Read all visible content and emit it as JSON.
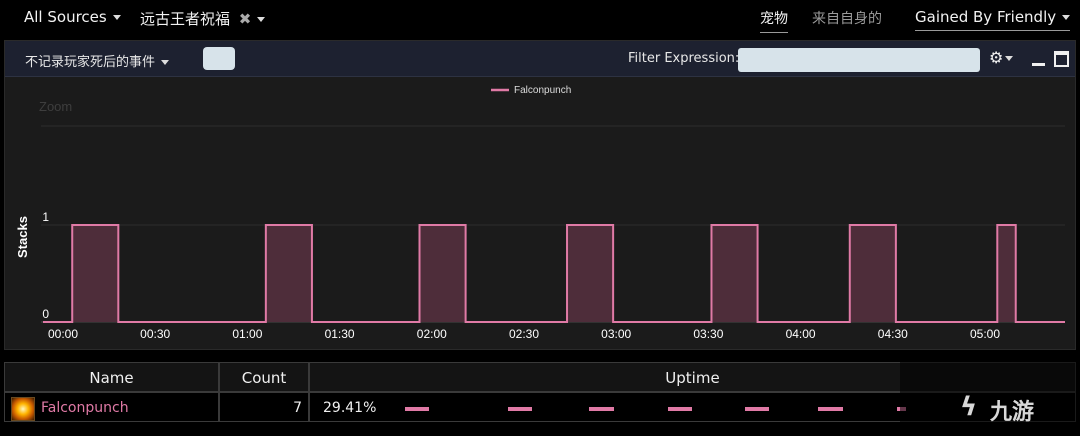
{
  "topbar": {
    "sources_label": "All Sources",
    "blessing_label": "远古王者祝福",
    "blessing_remove_glyph": "✖",
    "tab_pet": "宠物",
    "tab_self": "来自自身的",
    "mode_label": "Gained By Friendly"
  },
  "panel": {
    "death_filter_label": "不记录玩家死后的事件",
    "filter_label": "Filter Expression:",
    "filter_value": "",
    "gear_glyph": "⚙"
  },
  "chart_data": {
    "type": "line",
    "zoom_label": "Zoom",
    "ylabel": "Stacks",
    "ylim": [
      0,
      2
    ],
    "yticks": [
      0,
      1
    ],
    "xlim_seconds": [
      0,
      330
    ],
    "xticks": [
      "00:00",
      "00:30",
      "01:00",
      "01:30",
      "02:00",
      "02:30",
      "03:00",
      "03:30",
      "04:00",
      "04:30",
      "05:00"
    ],
    "series": [
      {
        "name": "Falconpunch",
        "color": "#e07aa6",
        "intervals": [
          {
            "start": "00:03",
            "end": "00:18"
          },
          {
            "start": "01:06",
            "end": "01:21"
          },
          {
            "start": "01:56",
            "end": "02:11"
          },
          {
            "start": "02:44",
            "end": "02:59"
          },
          {
            "start": "03:31",
            "end": "03:46"
          },
          {
            "start": "04:16",
            "end": "04:31"
          },
          {
            "start": "05:04",
            "end": "05:10"
          }
        ]
      }
    ]
  },
  "table": {
    "headers": {
      "name": "Name",
      "count": "Count",
      "uptime": "Uptime"
    },
    "rows": [
      {
        "name": "Falconpunch",
        "count": "7",
        "uptime": "29.41%",
        "icon": "explosion-icon"
      }
    ]
  },
  "watermark": {
    "text": "九游"
  }
}
